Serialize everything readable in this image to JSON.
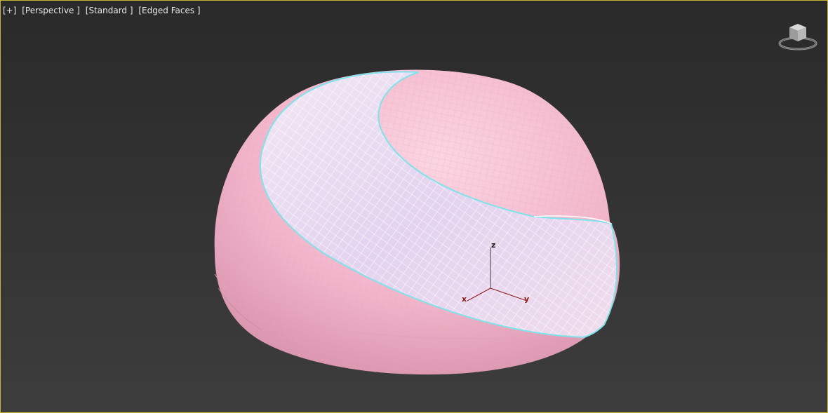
{
  "viewport": {
    "labels": {
      "menu": "[+]",
      "view": "[Perspective ]",
      "shading": "[Standard ]",
      "display": "[Edged Faces ]"
    },
    "active_border_color": "#c8b23a"
  },
  "viewcube": {
    "icon": "viewcube-icon"
  },
  "gizmo": {
    "axes": {
      "z": "z",
      "x": "x",
      "y": "y"
    },
    "colors": {
      "z": "#1a1a1a",
      "x": "#8c1a1a",
      "y": "#8c1a1a"
    }
  },
  "scene": {
    "mesh_color": "#f4bfd2",
    "selected_color": "#e8d6ee",
    "selection_edge_color": "#7fe3ea"
  }
}
